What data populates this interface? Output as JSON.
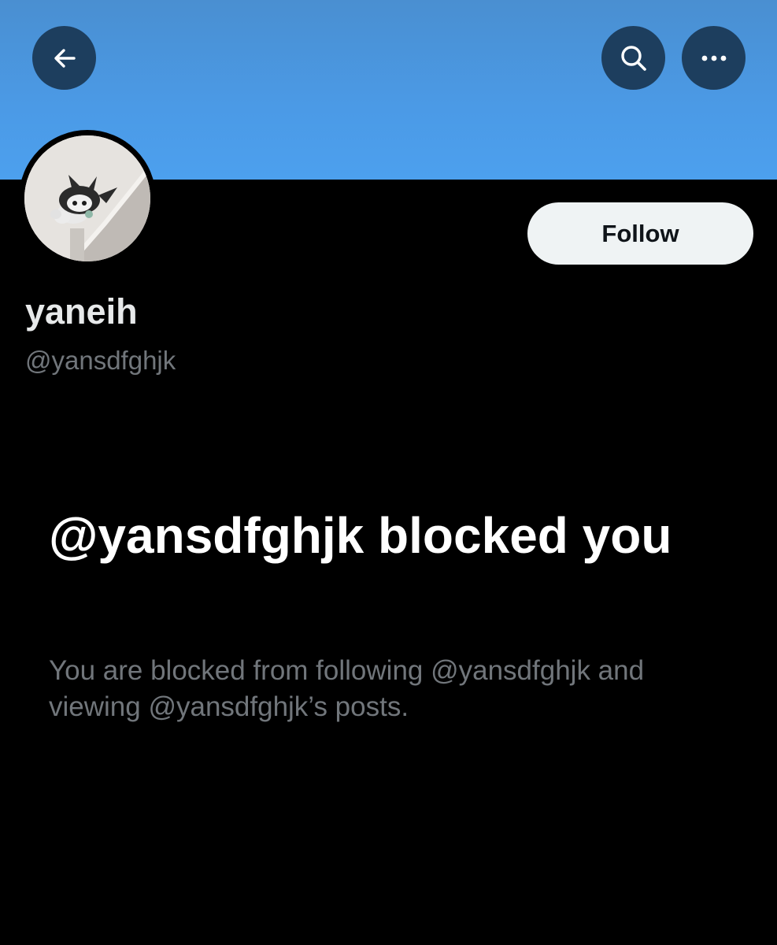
{
  "header": {
    "back_icon": "arrow-left-icon",
    "search_icon": "search-icon",
    "more_icon": "more-horizontal-icon",
    "banner_color": "#4b9ae6",
    "button_bg": "#1d3e5e"
  },
  "profile": {
    "display_name": "yaneih",
    "handle": "@yansdfghjk",
    "follow_label": "Follow"
  },
  "blocked": {
    "title": "@yansdfghjk blocked you",
    "description": "You are blocked from following @yansdfghjk and viewing @yansdfghjk’s posts."
  },
  "colors": {
    "background": "#000000",
    "primary_text": "#e7e9ea",
    "secondary_text": "#71767b",
    "follow_button_bg": "#eff3f4"
  }
}
